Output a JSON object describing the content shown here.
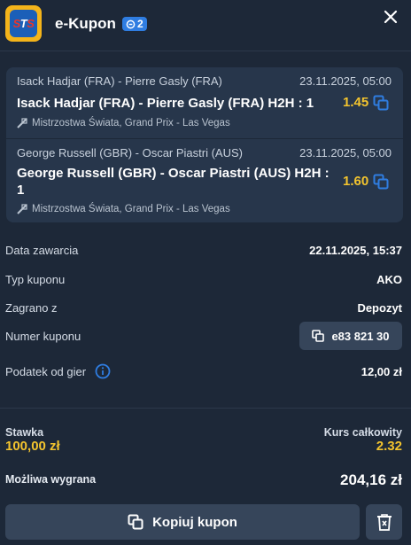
{
  "header": {
    "logo_text_a": "S",
    "logo_text_b": "T",
    "logo_text_c": "S",
    "title": "e-Kupon",
    "bet_count": "2"
  },
  "bets": [
    {
      "event": "Isack Hadjar (FRA) - Pierre Gasly (FRA)",
      "date": "23.11.2025, 05:00",
      "selection": "Isack Hadjar (FRA) - Pierre Gasly (FRA) H2H : 1",
      "odds": "1.45",
      "league": "Mistrzostwa Świata, Grand Prix - Las Vegas"
    },
    {
      "event": "George Russell (GBR) - Oscar Piastri (AUS)",
      "date": "23.11.2025, 05:00",
      "selection": "George Russell (GBR) - Oscar Piastri (AUS) H2H : 1",
      "odds": "1.60",
      "league": "Mistrzostwa Świata, Grand Prix - Las Vegas"
    }
  ],
  "details": {
    "date_label": "Data zawarcia",
    "date_value": "22.11.2025, 15:37",
    "type_label": "Typ kuponu",
    "type_value": "AKO",
    "played_label": "Zagrano z",
    "played_value": "Depozyt",
    "number_label": "Numer kuponu",
    "number_value": "e83 821 30",
    "tax_label": "Podatek od gier",
    "tax_value": "12,00 zł"
  },
  "summary": {
    "stake_label": "Stawka",
    "stake_value": "100,00 zł",
    "total_odds_label": "Kurs całkowity",
    "total_odds_value": "2.32",
    "win_label": "Możliwa wygrana",
    "win_value": "204,16 zł"
  },
  "actions": {
    "copy_label": "Kopiuj kupon"
  },
  "colors": {
    "background": "#1d2838",
    "card": "#27364b",
    "button": "#36455a",
    "accent_yellow": "#f3c42e",
    "accent_blue": "#2f7de1"
  },
  "icons": [
    "close-icon",
    "ticket-icon",
    "copy-icon",
    "info-icon",
    "trash-icon",
    "racing-icon"
  ]
}
